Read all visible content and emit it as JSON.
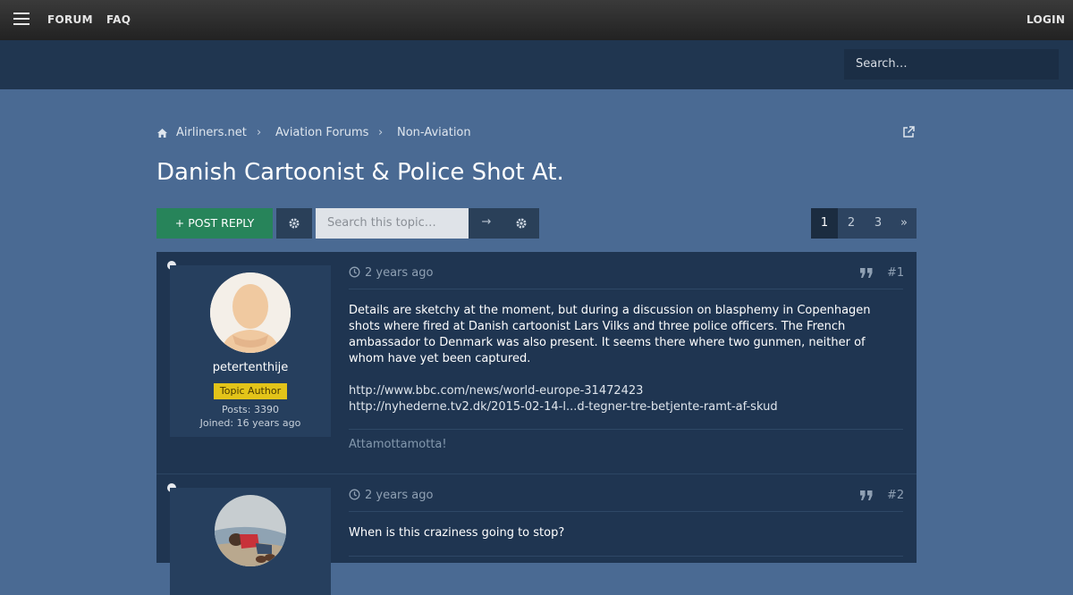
{
  "nav": {
    "forum": "FORUM",
    "faq": "FAQ",
    "login": "LOGIN"
  },
  "header": {
    "search_placeholder": "Search…"
  },
  "breadcrumb": [
    "Airliners.net",
    "Aviation Forums",
    "Non-Aviation"
  ],
  "topic": {
    "title": "Danish Cartoonist & Police Shot At."
  },
  "toolbar": {
    "post_reply": "+ POST REPLY",
    "search_placeholder": "Search this topic…"
  },
  "pagination": {
    "pages": [
      "1",
      "2",
      "3"
    ],
    "next": "»",
    "current": "1"
  },
  "posts": [
    {
      "author": "petertenthije",
      "badge": "Topic Author",
      "posts_count": "Posts: 3390",
      "joined": "Joined: 16 years ago",
      "time": "2 years ago",
      "number": "#1",
      "body": "Details are sketchy at the moment, but during a discussion on blasphemy in Copenhagen shots where fired at Danish cartoonist Lars Vilks and three police officers. The French ambassador to Denmark was also present. It seems there where two gunmen, neither of whom have yet been captured.",
      "links": [
        "http://www.bbc.com/news/world-europe-31472423",
        "http://nyhederne.tv2.dk/2015-02-14-l...d-tegner-tre-betjente-ramt-af-skud"
      ],
      "signature": "Attamottamotta!"
    },
    {
      "time": "2 years ago",
      "number": "#2",
      "body": "When is this craziness going to stop?"
    }
  ],
  "colors": {
    "background": "#4a6a93",
    "topbar": "#2b2b2b",
    "header": "#203650",
    "reply_button": "#27845a",
    "badge": "#e3c419",
    "post_panel": "#1f3551"
  }
}
